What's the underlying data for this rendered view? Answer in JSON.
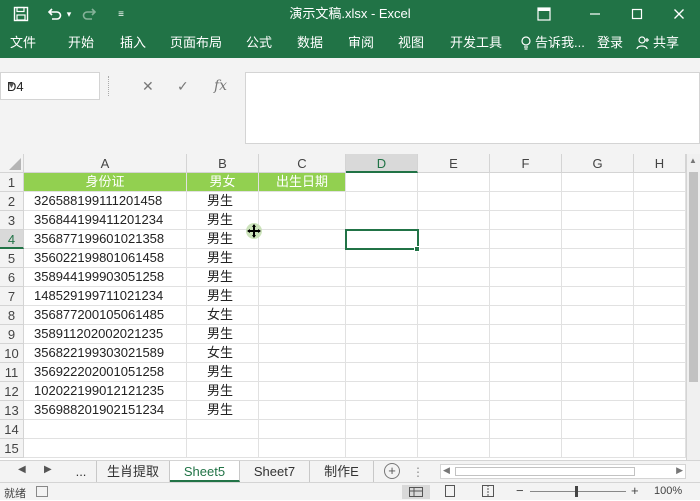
{
  "window": {
    "title": "演示文稿.xlsx - Excel",
    "sign_in": "登录",
    "share": "共享",
    "tell_me": "告诉我..."
  },
  "ribbon": {
    "tabs": [
      "文件",
      "开始",
      "插入",
      "页面布局",
      "公式",
      "数据",
      "审阅",
      "视图",
      "开发工具"
    ]
  },
  "name_box": {
    "value": "D4"
  },
  "formula": {
    "value": ""
  },
  "columns": [
    "A",
    "B",
    "C",
    "D",
    "E",
    "F",
    "G",
    "H"
  ],
  "rows": [
    "1",
    "2",
    "3",
    "4",
    "5",
    "6",
    "7",
    "8",
    "9",
    "10",
    "11",
    "12",
    "13",
    "14",
    "15"
  ],
  "selected": {
    "column": "D",
    "row": "4"
  },
  "sheet": {
    "header": [
      "身份证",
      "男女",
      "出生日期"
    ],
    "data": [
      [
        "326588199111201458",
        "男生"
      ],
      [
        "356844199411201234",
        "男生"
      ],
      [
        "356877199601021358",
        "男生"
      ],
      [
        "356022199801061458",
        "男生"
      ],
      [
        "358944199903051258",
        "男生"
      ],
      [
        "148529199711021234",
        "男生"
      ],
      [
        "356877200105061485",
        "女生"
      ],
      [
        "358911202002021235",
        "男生"
      ],
      [
        "356822199303021589",
        "女生"
      ],
      [
        "356922202001051258",
        "男生"
      ],
      [
        "102022199012121235",
        "男生"
      ],
      [
        "356988201902151234",
        "男生"
      ]
    ]
  },
  "sheet_tabs": [
    "...",
    "生肖提取",
    "Sheet5",
    "Sheet7",
    "制作E"
  ],
  "active_sheet": "Sheet5",
  "status": {
    "ready": "就绪",
    "zoom": "100%"
  },
  "colors": {
    "accent": "#217346",
    "header_fill": "#92d050"
  }
}
